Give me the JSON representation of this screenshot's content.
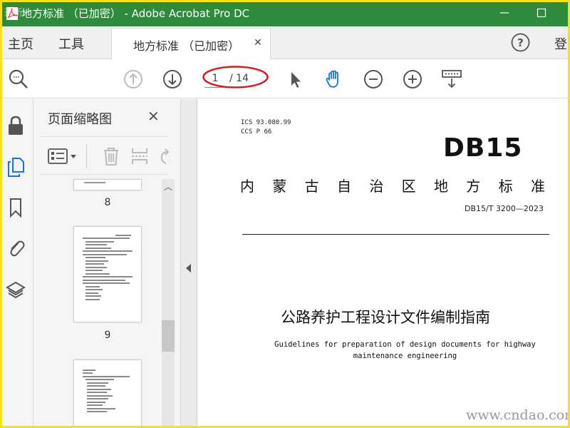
{
  "window": {
    "title": "地方标准 （已加密） - Adobe Acrobat Pro DC",
    "corner_watermark": "透析·"
  },
  "menu": {
    "home": "主页",
    "tools": "工具",
    "doc_tab": "地方标准 （已加密）",
    "sign_in": "登"
  },
  "toolbar": {
    "current_page": "1",
    "page_total": "/ 14"
  },
  "thumbnails": {
    "panel_title": "页面缩略图",
    "pages": [
      "8",
      "9"
    ]
  },
  "document": {
    "ics": "ICS  93.080.99",
    "ccs": "CCS  P 66",
    "code": "DB15",
    "standard_chars": [
      "内",
      "蒙",
      "古",
      "自",
      "治",
      "区",
      "地",
      "方",
      "标",
      "准"
    ],
    "number": "DB15/T 3200—2023",
    "title": "公路养护工程设计文件编制指南",
    "title_en_line1": "Guidelines for preparation of design documents for highway",
    "title_en_line2": "maintenance engineering"
  },
  "watermark": "www.cndao.com",
  "colors": {
    "titlebar": "#2e8b3c",
    "frame": "#f6e312",
    "highlight_ellipse": "#d21f1f",
    "hand_tool": "#1473e6"
  }
}
